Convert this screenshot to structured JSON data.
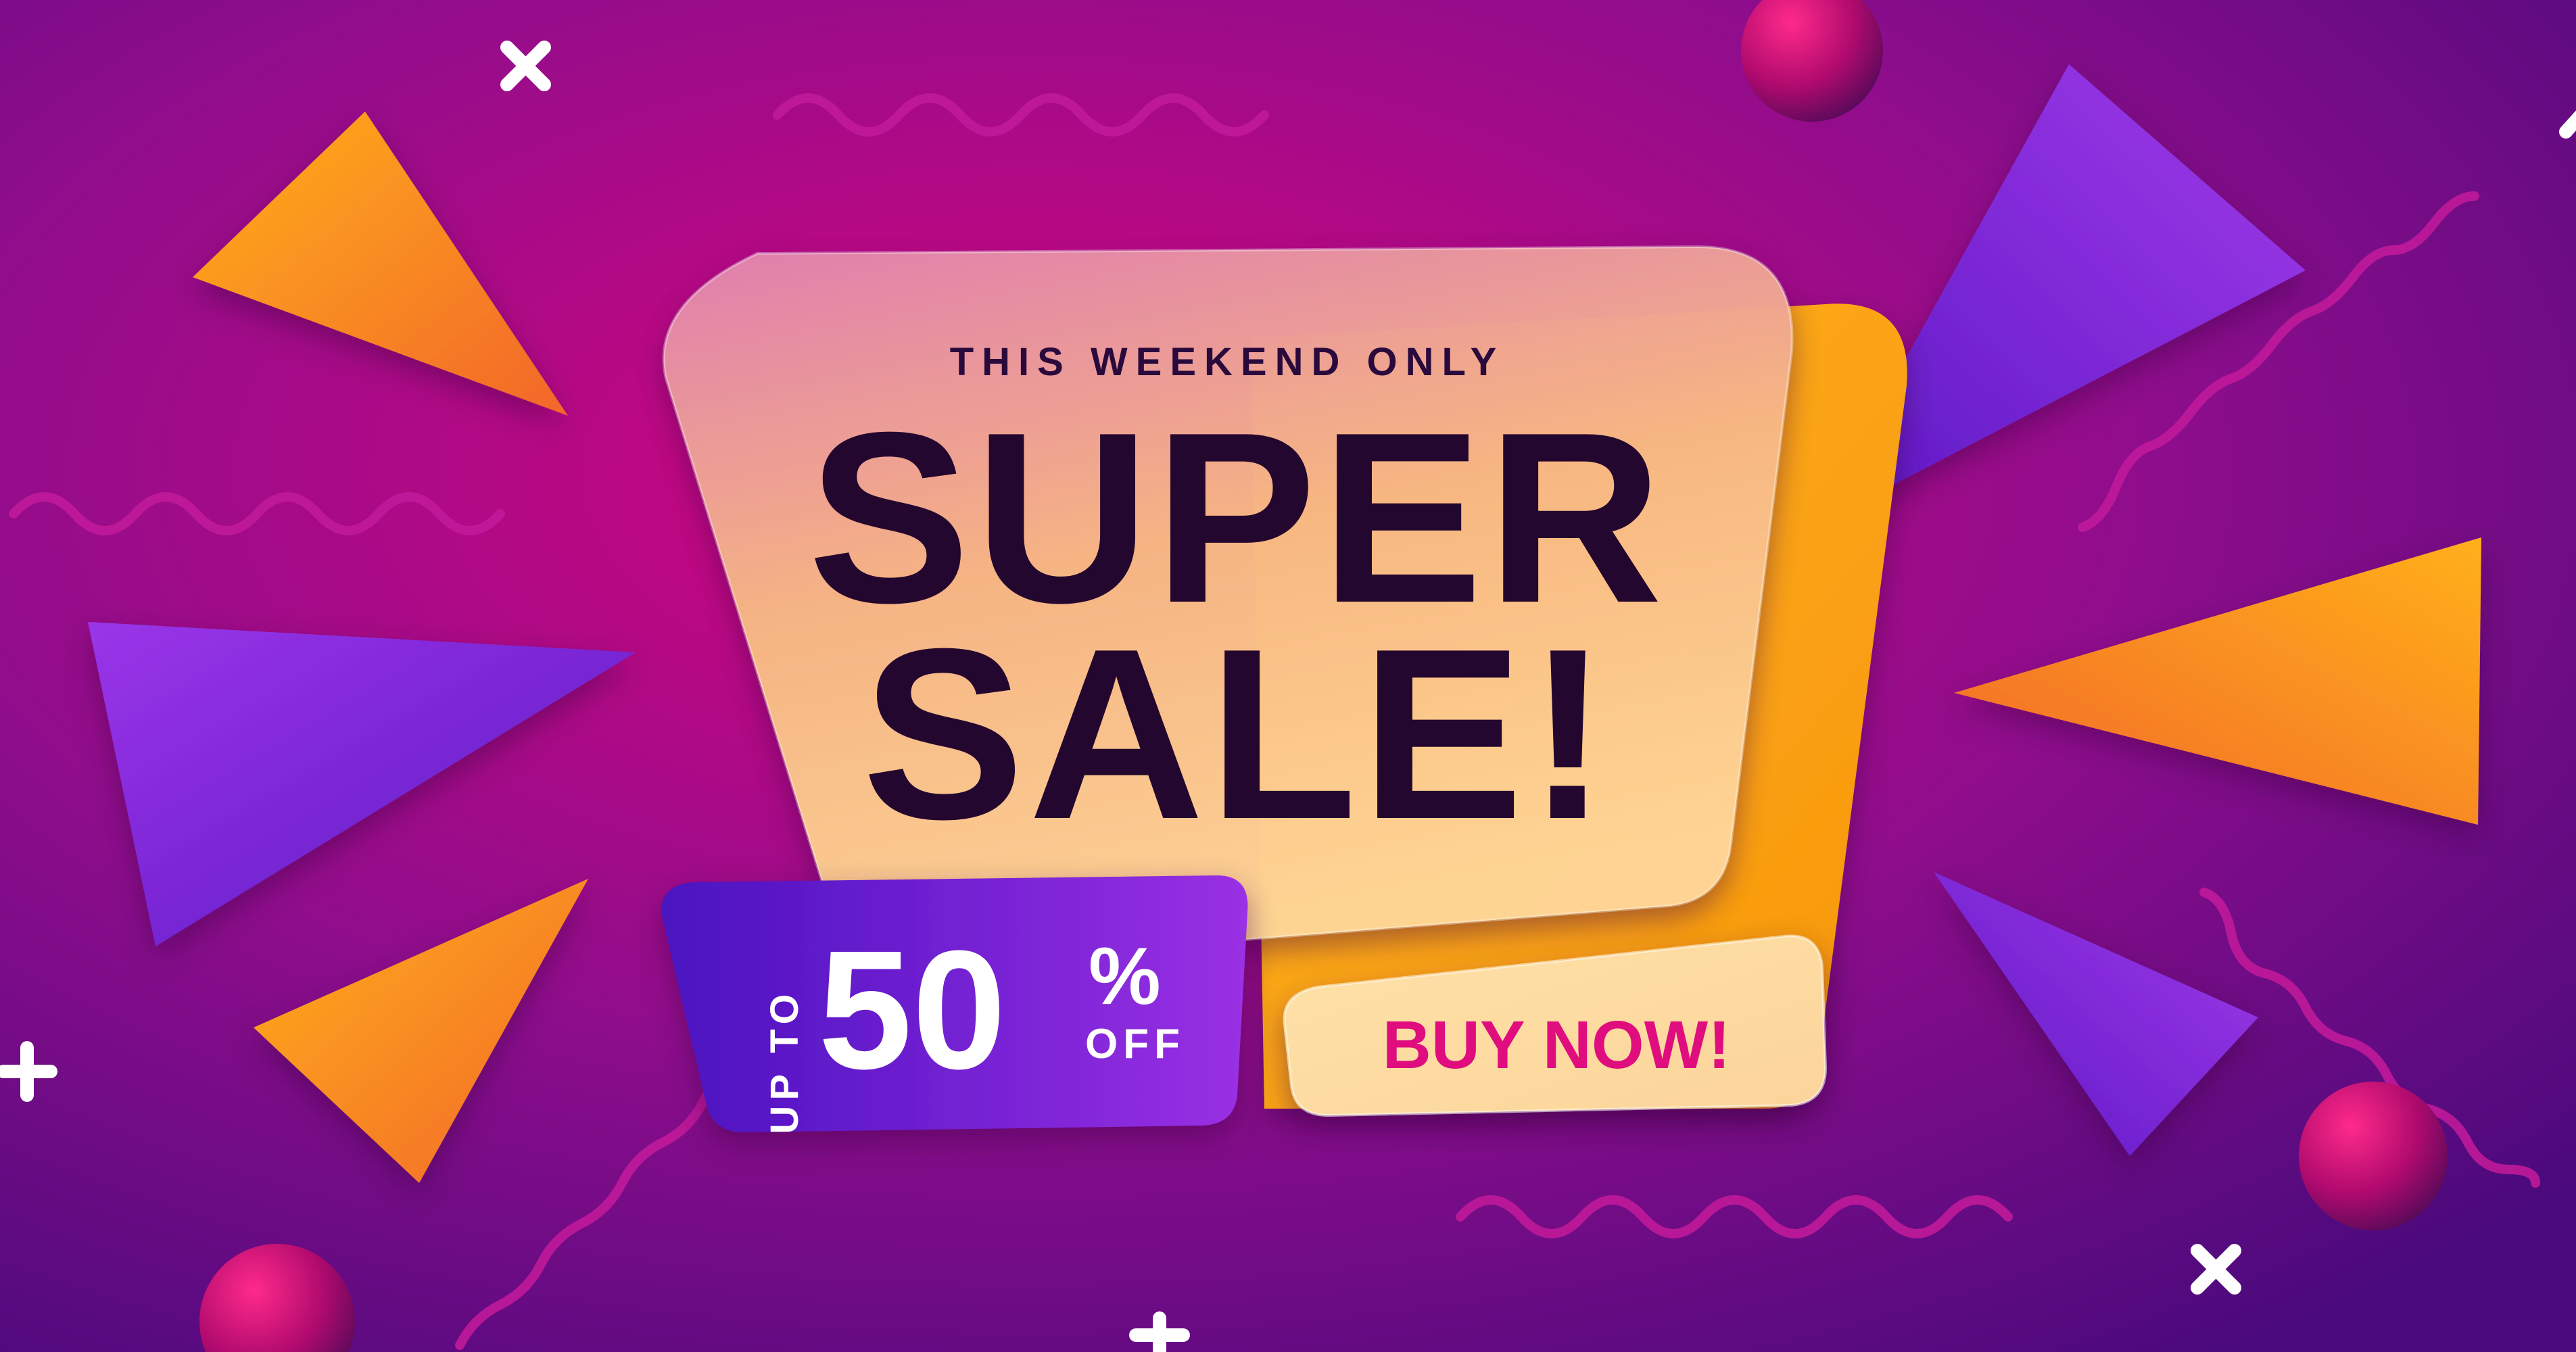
{
  "promo": {
    "tagline": "THIS WEEKEND ONLY",
    "headline_line1": "SUPER",
    "headline_line2": "SALE!",
    "discount_prefix": "UP TO",
    "discount_value": "50",
    "discount_unit": "%",
    "discount_suffix": "OFF",
    "cta_label": "BUY NOW!"
  },
  "colors": {
    "background_center": "#d4067f",
    "background_edge": "#4a0a7c",
    "orange_accent": "#ffa318",
    "orange_dark": "#f26b22",
    "purple_accent": "#8b2be0",
    "purple_dark": "#5b16c7",
    "headline_text": "#24072f",
    "cta_text": "#e0107e",
    "discount_panel": "#5a18d0"
  },
  "icons": [
    "x-mark-icon",
    "plus-icon",
    "sphere-icon",
    "triangle-icon",
    "wave-icon"
  ]
}
